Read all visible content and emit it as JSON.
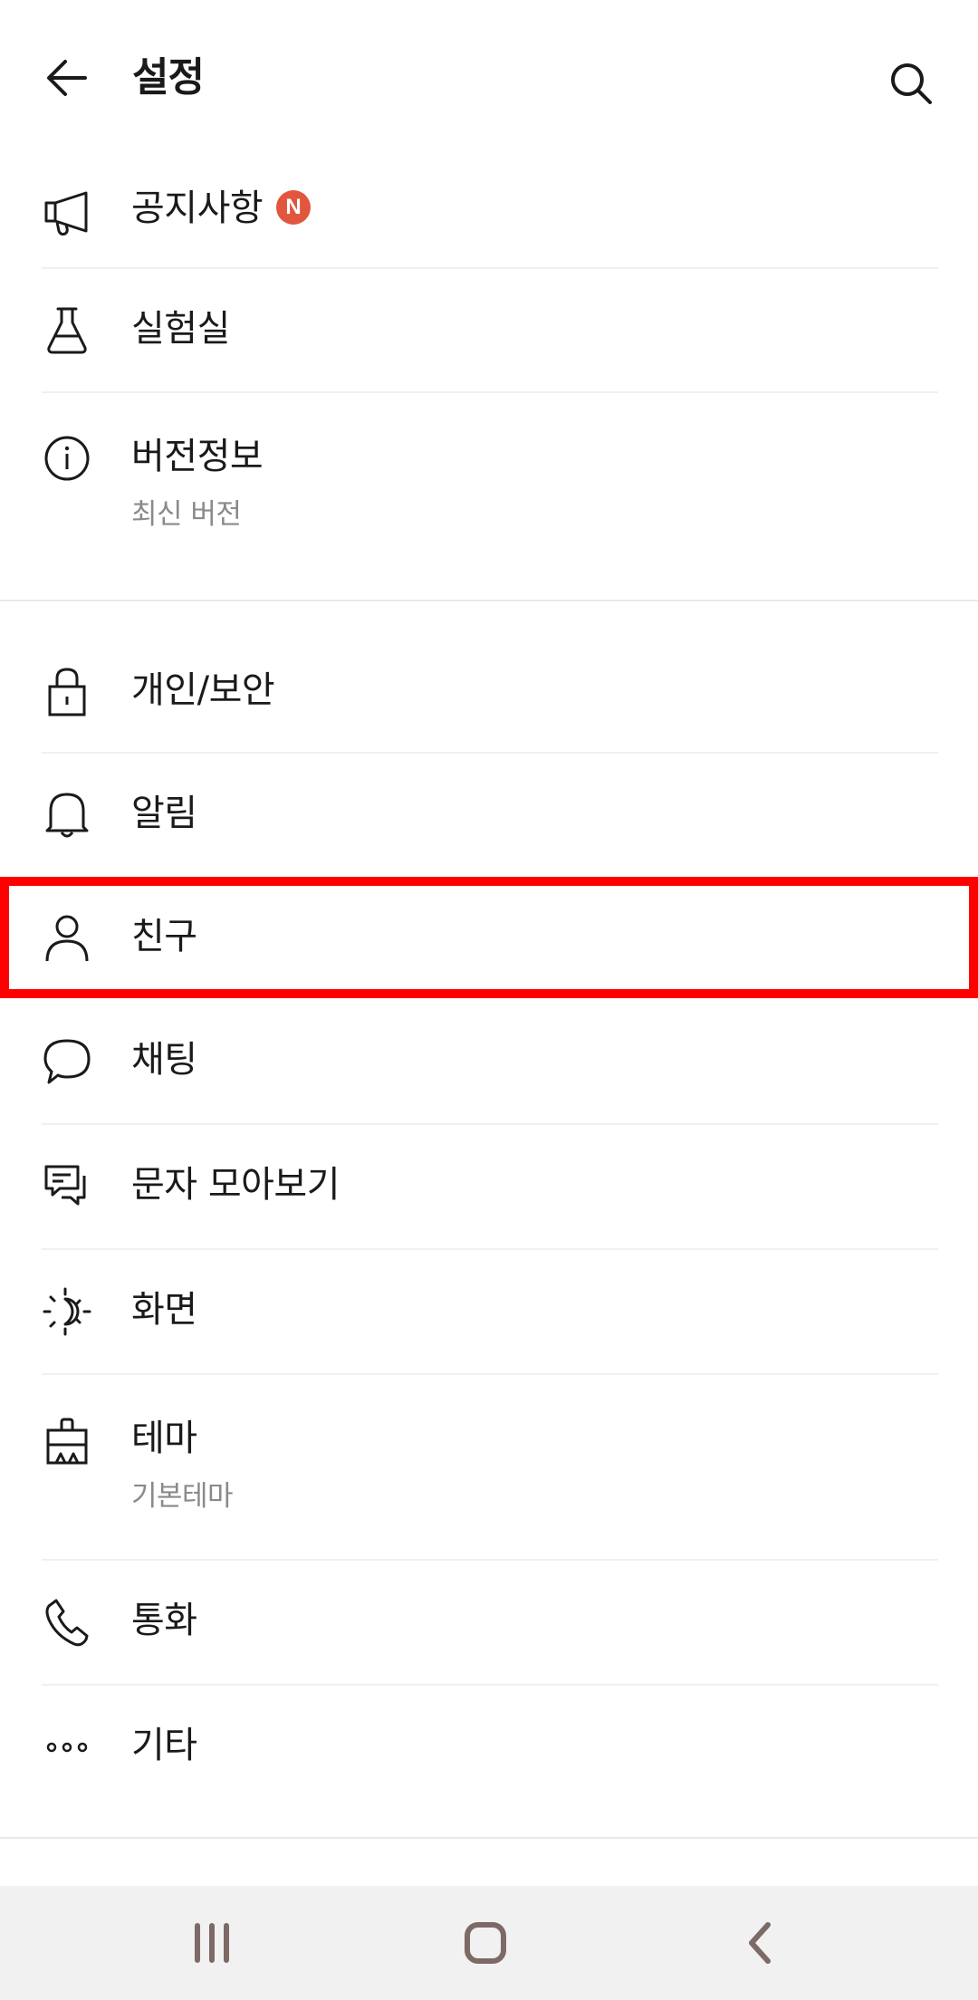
{
  "header": {
    "title": "설정",
    "back_icon": "back-arrow-icon",
    "search_icon": "search-icon"
  },
  "items": [
    {
      "key": "notice",
      "label": "공지사항",
      "icon": "megaphone-icon",
      "badge": "N"
    },
    {
      "key": "lab",
      "label": "실험실",
      "icon": "flask-icon"
    },
    {
      "key": "version",
      "label": "버전정보",
      "icon": "info-icon",
      "sub": "최신 버전"
    },
    {
      "key": "privacy",
      "label": "개인/보안",
      "icon": "lock-icon"
    },
    {
      "key": "alarm",
      "label": "알림",
      "icon": "bell-icon"
    },
    {
      "key": "friends",
      "label": "친구",
      "icon": "person-icon"
    },
    {
      "key": "chat",
      "label": "채팅",
      "icon": "chat-bubble-icon"
    },
    {
      "key": "sms",
      "label": "문자 모아보기",
      "icon": "message-stack-icon"
    },
    {
      "key": "screen",
      "label": "화면",
      "icon": "brightness-icon"
    },
    {
      "key": "theme",
      "label": "테마",
      "icon": "theme-brush-icon",
      "sub": "기본테마"
    },
    {
      "key": "call",
      "label": "통화",
      "icon": "phone-icon"
    },
    {
      "key": "etc",
      "label": "기타",
      "icon": "more-dots-icon"
    }
  ],
  "colors": {
    "badge": "#e1573d",
    "highlight": "#ff0000",
    "subtext": "#8a8a8a",
    "navbar": "#f1f1f1",
    "navicon": "#7d6a66"
  },
  "navbar": {
    "recent_icon": "recent-apps-icon",
    "home_icon": "home-icon",
    "back_icon": "nav-back-icon"
  }
}
